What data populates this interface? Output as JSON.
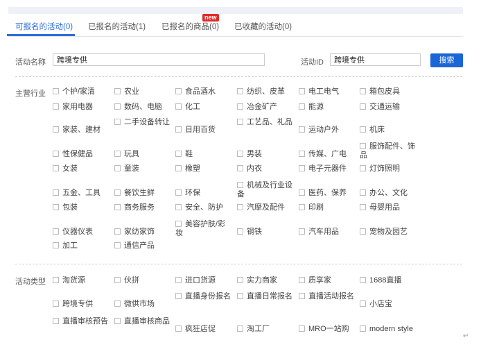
{
  "tabs": [
    {
      "label": "可报名的活动(0)"
    },
    {
      "label": "已报名的活动(1)"
    },
    {
      "label": "已报名的商品(0)"
    },
    {
      "label": "已收藏的活动(0)"
    }
  ],
  "new_badge": "new",
  "filters": {
    "name_label": "活动名称",
    "name_value": "跨境专供",
    "id_label": "活动ID",
    "id_value": "跨境专供",
    "search_label": "搜索"
  },
  "industry": {
    "label": "主营行业",
    "options": [
      "个护/家清",
      "农业",
      "食品酒水",
      "纺织、皮革",
      "电工电气",
      "箱包皮具",
      "家用电器",
      "数码、电脑",
      "化工",
      "冶金矿产",
      "能源",
      "交通运输",
      "家装、建材",
      "二手设备转让",
      "日用百货",
      "工艺品、礼品",
      "运动户外",
      "机床",
      "性保健品",
      "玩具",
      "鞋",
      "男装",
      "传媒、广电",
      "服饰配件、饰品",
      "女装",
      "童装",
      "橡塑",
      "内衣",
      "电子元器件",
      "灯饰照明",
      "五金、工具",
      "餐饮生鲜",
      "环保",
      "机械及行业设备",
      "医药、保养",
      "办公、文化",
      "包装",
      "商务服务",
      "安全、防护",
      "汽摩及配件",
      "印刷",
      "母婴用品",
      "仪器仪表",
      "家纺家饰",
      "美容护肤/彩妆",
      "钢铁",
      "汽车用品",
      "宠物及园艺",
      "加工",
      "通信产品"
    ]
  },
  "activity_type": {
    "label": "活动类型",
    "options": [
      "淘货源",
      "伙拼",
      "进口货源",
      "实力商家",
      "质享家",
      "1688直播",
      "跨境专供",
      "微供市场",
      "直播身份报名",
      "直播日常报名",
      "直播活动报名",
      "小店宝",
      "直播审核预告",
      "直播审核商品",
      "疯狂店促",
      "淘工厂",
      "MRO一站购",
      "modern style"
    ]
  },
  "end_mark": "↵"
}
